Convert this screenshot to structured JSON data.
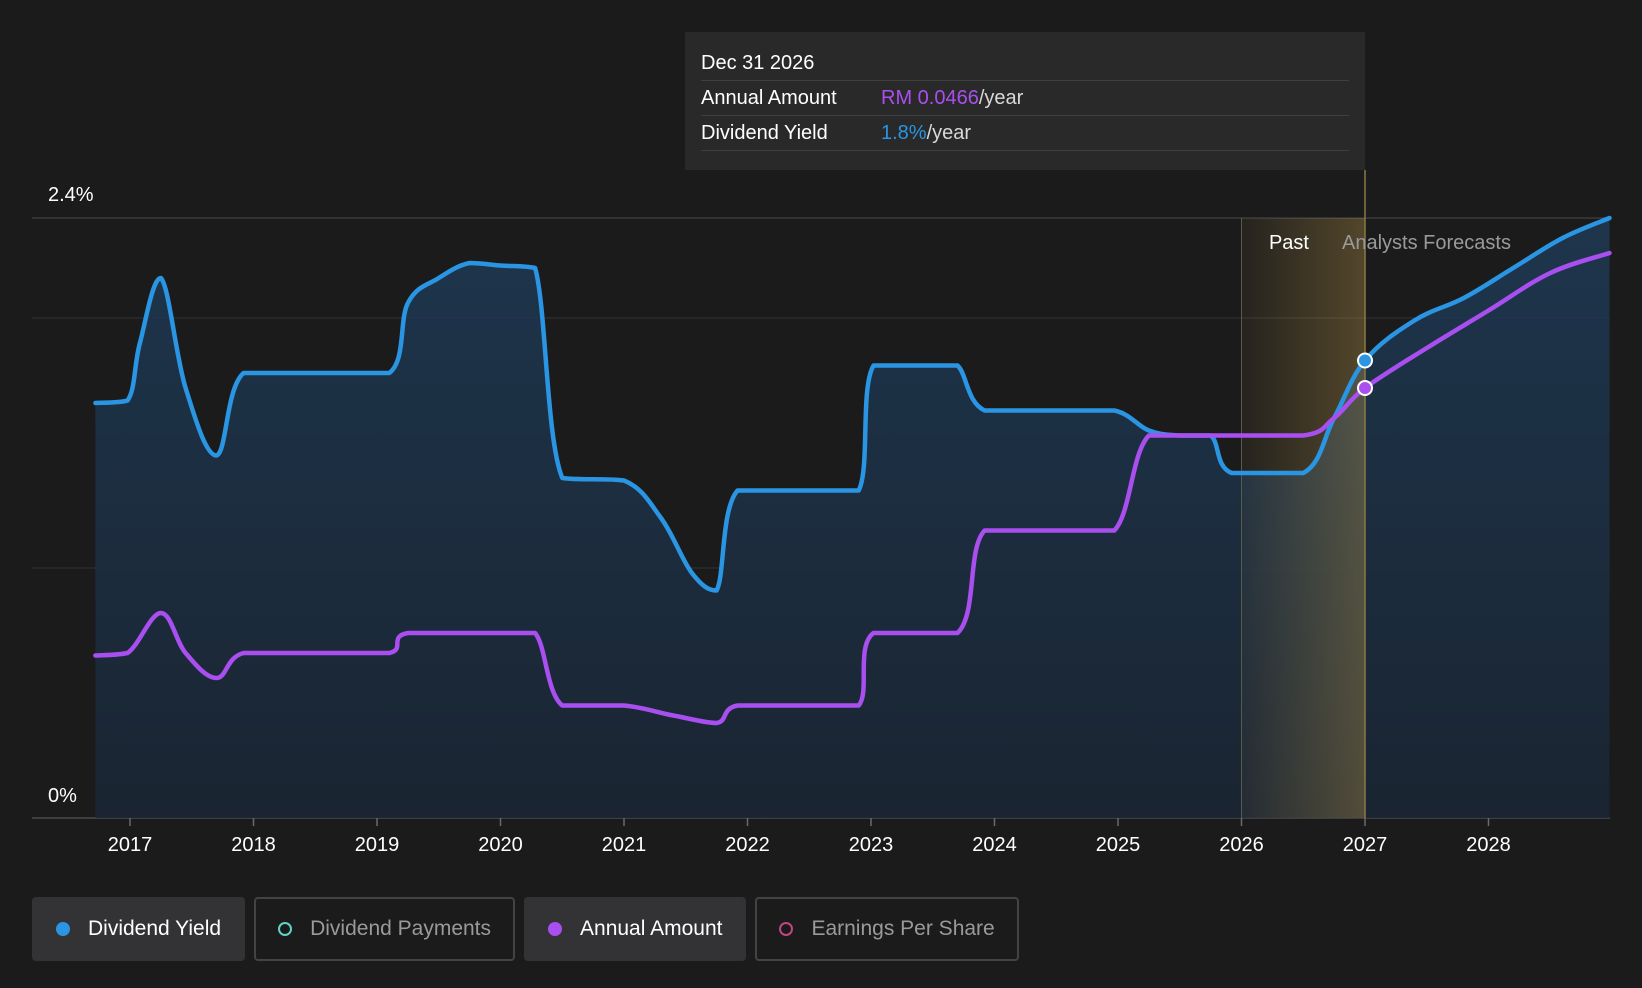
{
  "chart_data": {
    "type": "line",
    "x_axis": {
      "ticks": [
        "2017",
        "2018",
        "2019",
        "2020",
        "2021",
        "2022",
        "2023",
        "2024",
        "2025",
        "2026",
        "2027",
        "2028"
      ],
      "range": [
        2016.72,
        2028.98
      ]
    },
    "y_axis": {
      "top_label": "2.4%",
      "bottom_label": "0%",
      "range": [
        0,
        2.4
      ],
      "grid": [
        0,
        1.0,
        2.0,
        2.4
      ]
    },
    "zones": {
      "past_label": "Past",
      "forecast_label": "Analysts Forecasts",
      "highlight_start": 2026.0,
      "divider": 2027.0
    },
    "series": [
      {
        "name": "Dividend Yield",
        "color": "#2a95e2",
        "points": [
          [
            2016.72,
            1.66
          ],
          [
            2016.98,
            1.67
          ],
          [
            2017.08,
            1.9
          ],
          [
            2017.25,
            2.16
          ],
          [
            2017.45,
            1.72
          ],
          [
            2017.7,
            1.45
          ],
          [
            2017.92,
            1.78
          ],
          [
            2018.5,
            1.78
          ],
          [
            2019.1,
            1.78
          ],
          [
            2019.25,
            2.06
          ],
          [
            2019.5,
            2.16
          ],
          [
            2019.75,
            2.22
          ],
          [
            2020.0,
            2.21
          ],
          [
            2020.28,
            2.2
          ],
          [
            2020.5,
            1.36
          ],
          [
            2021.0,
            1.35
          ],
          [
            2021.3,
            1.2
          ],
          [
            2021.55,
            0.98
          ],
          [
            2021.75,
            0.91
          ],
          [
            2021.92,
            1.31
          ],
          [
            2022.5,
            1.31
          ],
          [
            2022.9,
            1.31
          ],
          [
            2023.02,
            1.81
          ],
          [
            2023.5,
            1.81
          ],
          [
            2023.7,
            1.81
          ],
          [
            2023.92,
            1.63
          ],
          [
            2024.5,
            1.63
          ],
          [
            2024.97,
            1.63
          ],
          [
            2025.25,
            1.55
          ],
          [
            2025.5,
            1.53
          ],
          [
            2025.75,
            1.53
          ],
          [
            2025.92,
            1.38
          ],
          [
            2026.5,
            1.38
          ],
          [
            2026.75,
            1.6
          ],
          [
            2027.0,
            1.83
          ],
          [
            2027.4,
            1.99
          ],
          [
            2027.8,
            2.08
          ],
          [
            2028.2,
            2.2
          ],
          [
            2028.6,
            2.32
          ],
          [
            2028.98,
            2.4
          ]
        ]
      },
      {
        "name": "Annual Amount",
        "color": "#a94ff0",
        "points": [
          [
            2016.72,
            0.65
          ],
          [
            2016.98,
            0.66
          ],
          [
            2017.25,
            0.82
          ],
          [
            2017.45,
            0.66
          ],
          [
            2017.7,
            0.56
          ],
          [
            2017.92,
            0.66
          ],
          [
            2018.5,
            0.66
          ],
          [
            2019.1,
            0.66
          ],
          [
            2019.25,
            0.74
          ],
          [
            2020.0,
            0.74
          ],
          [
            2020.28,
            0.74
          ],
          [
            2020.5,
            0.45
          ],
          [
            2021.0,
            0.45
          ],
          [
            2021.4,
            0.41
          ],
          [
            2021.75,
            0.38
          ],
          [
            2021.92,
            0.45
          ],
          [
            2022.5,
            0.45
          ],
          [
            2022.9,
            0.45
          ],
          [
            2023.02,
            0.74
          ],
          [
            2023.7,
            0.74
          ],
          [
            2023.92,
            1.15
          ],
          [
            2024.5,
            1.15
          ],
          [
            2024.97,
            1.15
          ],
          [
            2025.25,
            1.53
          ],
          [
            2025.75,
            1.53
          ],
          [
            2026.5,
            1.53
          ],
          [
            2026.75,
            1.6
          ],
          [
            2027.0,
            1.72
          ],
          [
            2027.5,
            1.88
          ],
          [
            2028.0,
            2.03
          ],
          [
            2028.5,
            2.18
          ],
          [
            2028.98,
            2.26
          ]
        ]
      }
    ],
    "markers": [
      {
        "series": "Dividend Yield",
        "x": 2027.0,
        "y": 1.83
      },
      {
        "series": "Annual Amount",
        "x": 2027.0,
        "y": 1.72
      }
    ],
    "tooltip": {
      "date": "Dec 31 2026",
      "rows": [
        {
          "label": "Annual Amount",
          "value": "RM 0.0466",
          "unit": "/year"
        },
        {
          "label": "Dividend Yield",
          "value": "1.8%",
          "unit": "/year"
        }
      ]
    }
  },
  "legend": [
    {
      "label": "Dividend Yield",
      "color": "#2a95e2",
      "active": true
    },
    {
      "label": "Dividend Payments",
      "color": "#5fd4c4",
      "active": false
    },
    {
      "label": "Annual Amount",
      "color": "#a94ff0",
      "active": true
    },
    {
      "label": "Earnings Per Share",
      "color": "#c2457e",
      "active": false
    }
  ]
}
